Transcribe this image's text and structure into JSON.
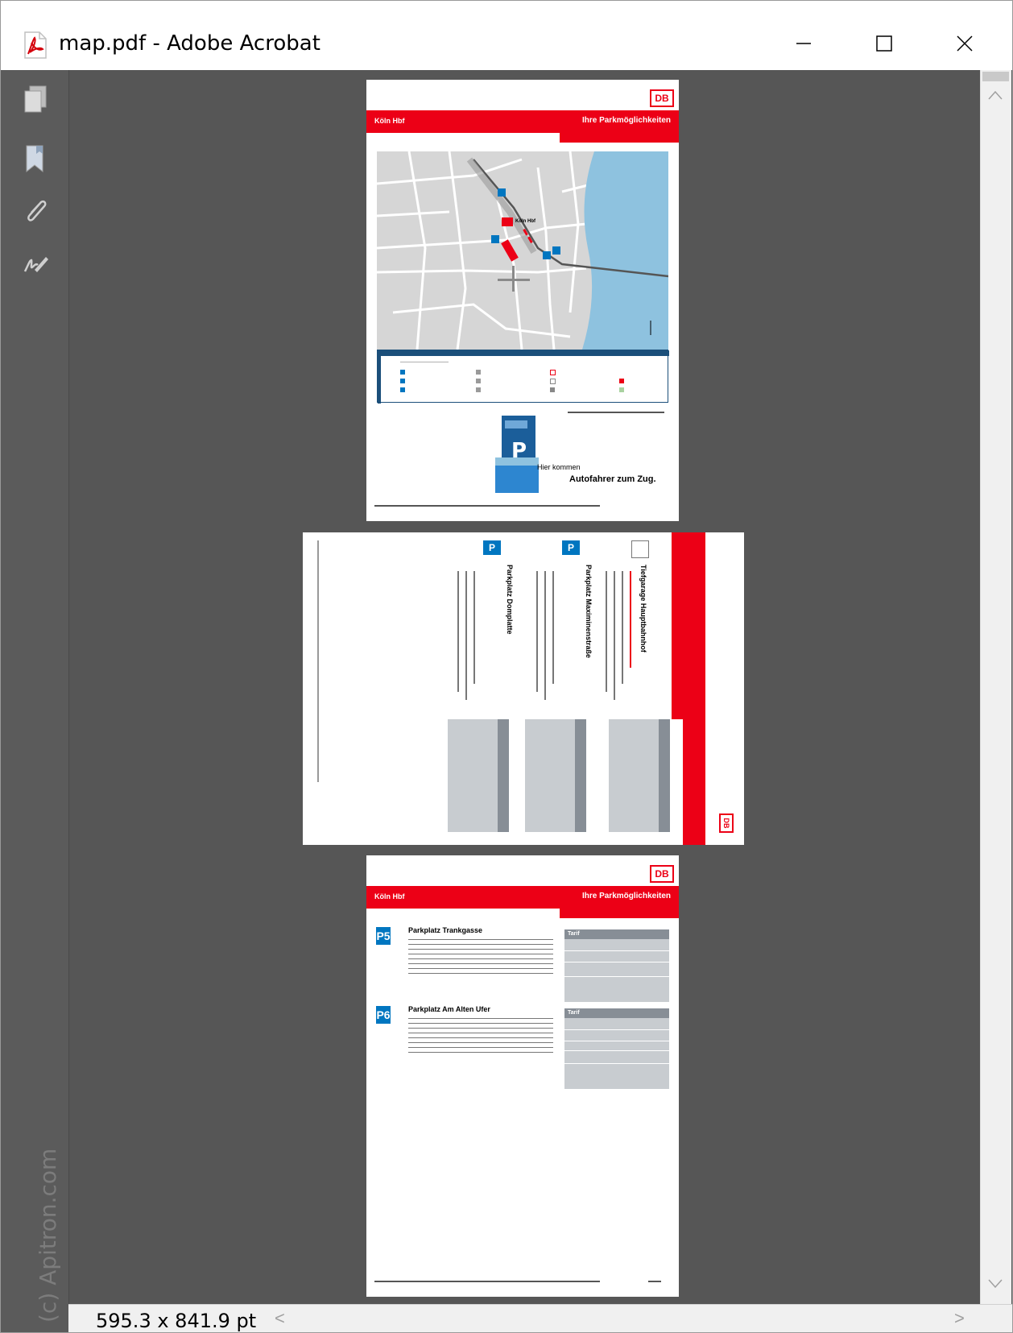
{
  "window": {
    "title": "map.pdf - Adobe Acrobat",
    "controls": {
      "minimize": "—",
      "maximize": "☐",
      "close": "✕"
    }
  },
  "sidebar": {
    "icons": [
      "pages-icon",
      "bookmark-icon",
      "attachment-icon",
      "signature-icon"
    ],
    "watermark": "(c) Apitron.com"
  },
  "statusbar": {
    "page_size": "595.3 x 841.9 pt",
    "scroll_left": "<",
    "scroll_right": ">"
  },
  "pdf": {
    "logo": "DB",
    "station": "Köln Hbf",
    "header_title": "Ihre Parkmöglichkeiten",
    "map_labels": {
      "station": "Köln Hbf"
    },
    "promo": {
      "line1": "Hier kommen",
      "line2": "Autofahrer zum Zug."
    },
    "page2_headings": [
      "Tiefgarage Hauptbahnhof",
      "Parkplatz Maximinenstraße",
      "Parkplatz Domplatte"
    ],
    "page3": {
      "p5_label": "P5",
      "p5_title": "Parkplatz Trankgasse",
      "p6_label": "P6",
      "p6_title": "Parkplatz Am Alten Ufer",
      "tarif_label": "Tarif"
    }
  },
  "colors": {
    "db_red": "#ec0016",
    "p_blue": "#0076c0",
    "river": "#8ec2df",
    "viewer_bg": "#565656"
  }
}
